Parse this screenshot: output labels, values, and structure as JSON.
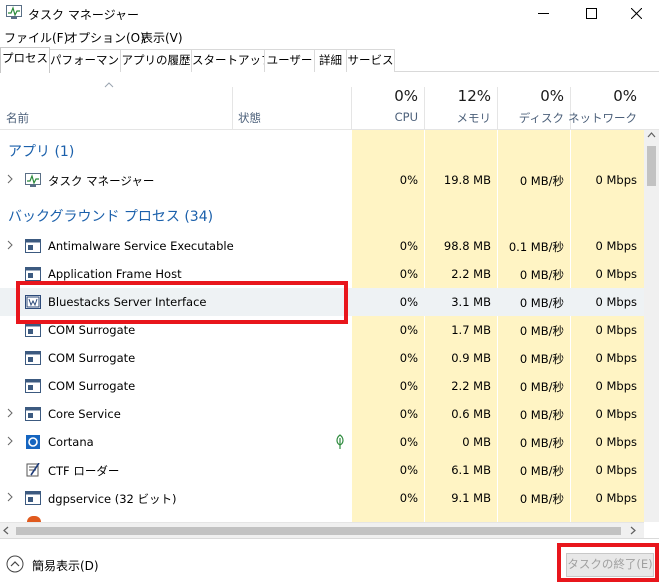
{
  "window": {
    "title": "タスク マネージャー",
    "app_icon": "task-manager-icon"
  },
  "menu": [
    "ファイル(F)",
    "オプション(O)",
    "表示(V)"
  ],
  "tabs": [
    {
      "label": "プロセス",
      "active": true
    },
    {
      "label": "パフォーマンス",
      "active": false
    },
    {
      "label": "アプリの履歴",
      "active": false
    },
    {
      "label": "スタートアップ",
      "active": false
    },
    {
      "label": "ユーザー",
      "active": false
    },
    {
      "label": "詳細",
      "active": false
    },
    {
      "label": "サービス",
      "active": false
    }
  ],
  "columns": {
    "name": "名前",
    "status": "状態",
    "cpu": {
      "percent": "0%",
      "label": "CPU"
    },
    "memory": {
      "percent": "12%",
      "label": "メモリ"
    },
    "disk": {
      "percent": "0%",
      "label": "ディスク"
    },
    "network": {
      "percent": "0%",
      "label": "ネットワーク"
    }
  },
  "colors": {
    "group_label": "#1b60ab",
    "column_highlight": "#fff4c4",
    "annotation": "#e8161c",
    "selected_row": "#eef2f4"
  },
  "groups": {
    "apps": "アプリ (1)",
    "background": "バックグラウンド プロセス (34)"
  },
  "processes": [
    {
      "name": "タスク マネージャー",
      "icon": "task-manager-icon",
      "expandable": true,
      "cpu": "0%",
      "memory": "19.8 MB",
      "disk": "0 MB/秒",
      "network": "0 Mbps"
    },
    {
      "name": "Antimalware Service Executable",
      "icon": "window-icon",
      "expandable": true,
      "cpu": "0%",
      "memory": "98.8 MB",
      "disk": "0.1 MB/秒",
      "network": "0 Mbps"
    },
    {
      "name": "Application Frame Host",
      "icon": "window-icon",
      "expandable": false,
      "cpu": "0%",
      "memory": "2.2 MB",
      "disk": "0 MB/秒",
      "network": "0 Mbps"
    },
    {
      "name": "Bluestacks Server Interface",
      "icon": "bluestacks-icon",
      "expandable": false,
      "selected": true,
      "cpu": "0%",
      "memory": "3.1 MB",
      "disk": "0 MB/秒",
      "network": "0 Mbps"
    },
    {
      "name": "COM Surrogate",
      "icon": "window-icon",
      "expandable": false,
      "cpu": "0%",
      "memory": "1.7 MB",
      "disk": "0 MB/秒",
      "network": "0 Mbps"
    },
    {
      "name": "COM Surrogate",
      "icon": "window-icon",
      "expandable": false,
      "cpu": "0%",
      "memory": "0.9 MB",
      "disk": "0 MB/秒",
      "network": "0 Mbps"
    },
    {
      "name": "COM Surrogate",
      "icon": "window-icon",
      "expandable": false,
      "cpu": "0%",
      "memory": "2.2 MB",
      "disk": "0 MB/秒",
      "network": "0 Mbps"
    },
    {
      "name": "Core Service",
      "icon": "window-icon",
      "expandable": true,
      "cpu": "0%",
      "memory": "0.6 MB",
      "disk": "0 MB/秒",
      "network": "0 Mbps"
    },
    {
      "name": "Cortana",
      "icon": "cortana-icon",
      "expandable": true,
      "status_icon": "leaf-icon",
      "cpu": "0%",
      "memory": "0 MB",
      "disk": "0 MB/秒",
      "network": "0 Mbps"
    },
    {
      "name": "CTF ローダー",
      "icon": "ctf-loader-icon",
      "expandable": false,
      "cpu": "0%",
      "memory": "6.1 MB",
      "disk": "0 MB/秒",
      "network": "0 Mbps"
    },
    {
      "name": "dgpservice (32 ビット)",
      "icon": "window-icon",
      "expandable": true,
      "cpu": "0%",
      "memory": "9.1 MB",
      "disk": "0 MB/秒",
      "network": "0 Mbps"
    }
  ],
  "footer": {
    "fewer_details": "簡易表示(D)",
    "end_task": "タスクの終了(E)"
  }
}
